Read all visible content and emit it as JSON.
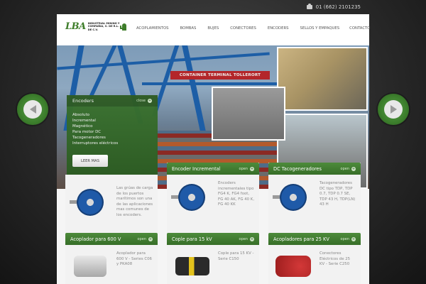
{
  "topbar": {
    "phone": "01 (662) 2101235",
    "phone_icon": "phone-icon"
  },
  "logo": {
    "mark": "LBA",
    "text": "INDUSTRIAL MINING Y COMPAÑIA, S. DE R.L. DE C.V.",
    "icon": "cactus-icon"
  },
  "nav": {
    "items": [
      "ACOPLAMIENTOS",
      "BOMBAS",
      "BUJES",
      "CONECTORES",
      "ENCODERS",
      "SELLOS Y EMPAQUES",
      "CONTACTO"
    ]
  },
  "hero": {
    "banner": "CONTAINER TERMINAL TOLLERORT",
    "panel": {
      "title": "Encoders",
      "close_label": "close",
      "items": [
        "Absoluto",
        "Incremental",
        "Magnético",
        "Para motor DC",
        "Tacogeneradores",
        "Interruptores eléctricos"
      ],
      "button": "LEER MAS"
    }
  },
  "cards": [
    {
      "title": "",
      "open": "",
      "text": "Las grúas de carga de los puertos marítimos son una de las aplicaciones mas comunes de los encoders."
    },
    {
      "title": "Encoder Incremental",
      "open": "open",
      "text": "Encoders incrementales tipo FG4 K, FG4 foot, FG 40 AK, FG 40 K, FG 40 KK"
    },
    {
      "title": "DC Tacogeneradores",
      "open": "open",
      "text": "Tacogeneradores DC tipo TDP, TDP 0.7, TDP 0.7 SE, TDP 43 H, TDP(LN) 43 H"
    },
    {
      "title": "Acoplador para 600 V",
      "open": "open",
      "text": "Acoplador para 600 V - Series C06 y PKA08"
    },
    {
      "title": "Cople para 15 kV",
      "open": "open",
      "text": "Cople para 15 KV - Serie C150"
    },
    {
      "title": "Acopladores para 25 KV",
      "open": "open",
      "text": "Conectores Eléctricos de 25 KV - Serie C250"
    }
  ],
  "colors": {
    "green": "#3c7e2c",
    "crane_blue": "#1d5ea6",
    "banner_red": "#b3262a"
  }
}
